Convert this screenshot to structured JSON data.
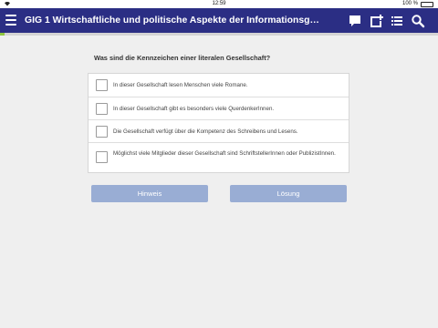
{
  "statusbar": {
    "wifi_icon": "wifi-icon",
    "time": "12:59",
    "battery_text": "100 %",
    "battery_level": 1.0
  },
  "appbar": {
    "title": "GIG 1 Wirtschaftliche und politische Aspekte der Informationsgesell...",
    "color": "#2b2e84",
    "icons": [
      "menu-icon",
      "chat-icon",
      "add-note-icon",
      "list-icon",
      "search-icon"
    ]
  },
  "progress": {
    "color": "#8fc63f",
    "value": 0.01
  },
  "quiz": {
    "question": "Was sind die Kennzeichen einer literalen Gesellschaft?",
    "answers": [
      {
        "text": "In dieser Gesellschaft lesen Menschen viele Romane.",
        "checked": false
      },
      {
        "text": "In dieser Gesellschaft gibt es besonders viele QuerdenkerInnen.",
        "checked": false
      },
      {
        "text": "Die Gesellschaft verfügt über die Kompetenz des Schreibens und Lesens.",
        "checked": false
      },
      {
        "text": "Möglichst viele Mitglieder dieser Gesellschaft sind SchriftstellerInnen oder PublizistInnen.",
        "checked": false
      }
    ]
  },
  "buttons": {
    "hint": "Hinweis",
    "solution": "Lösung",
    "color": "#99add4"
  }
}
